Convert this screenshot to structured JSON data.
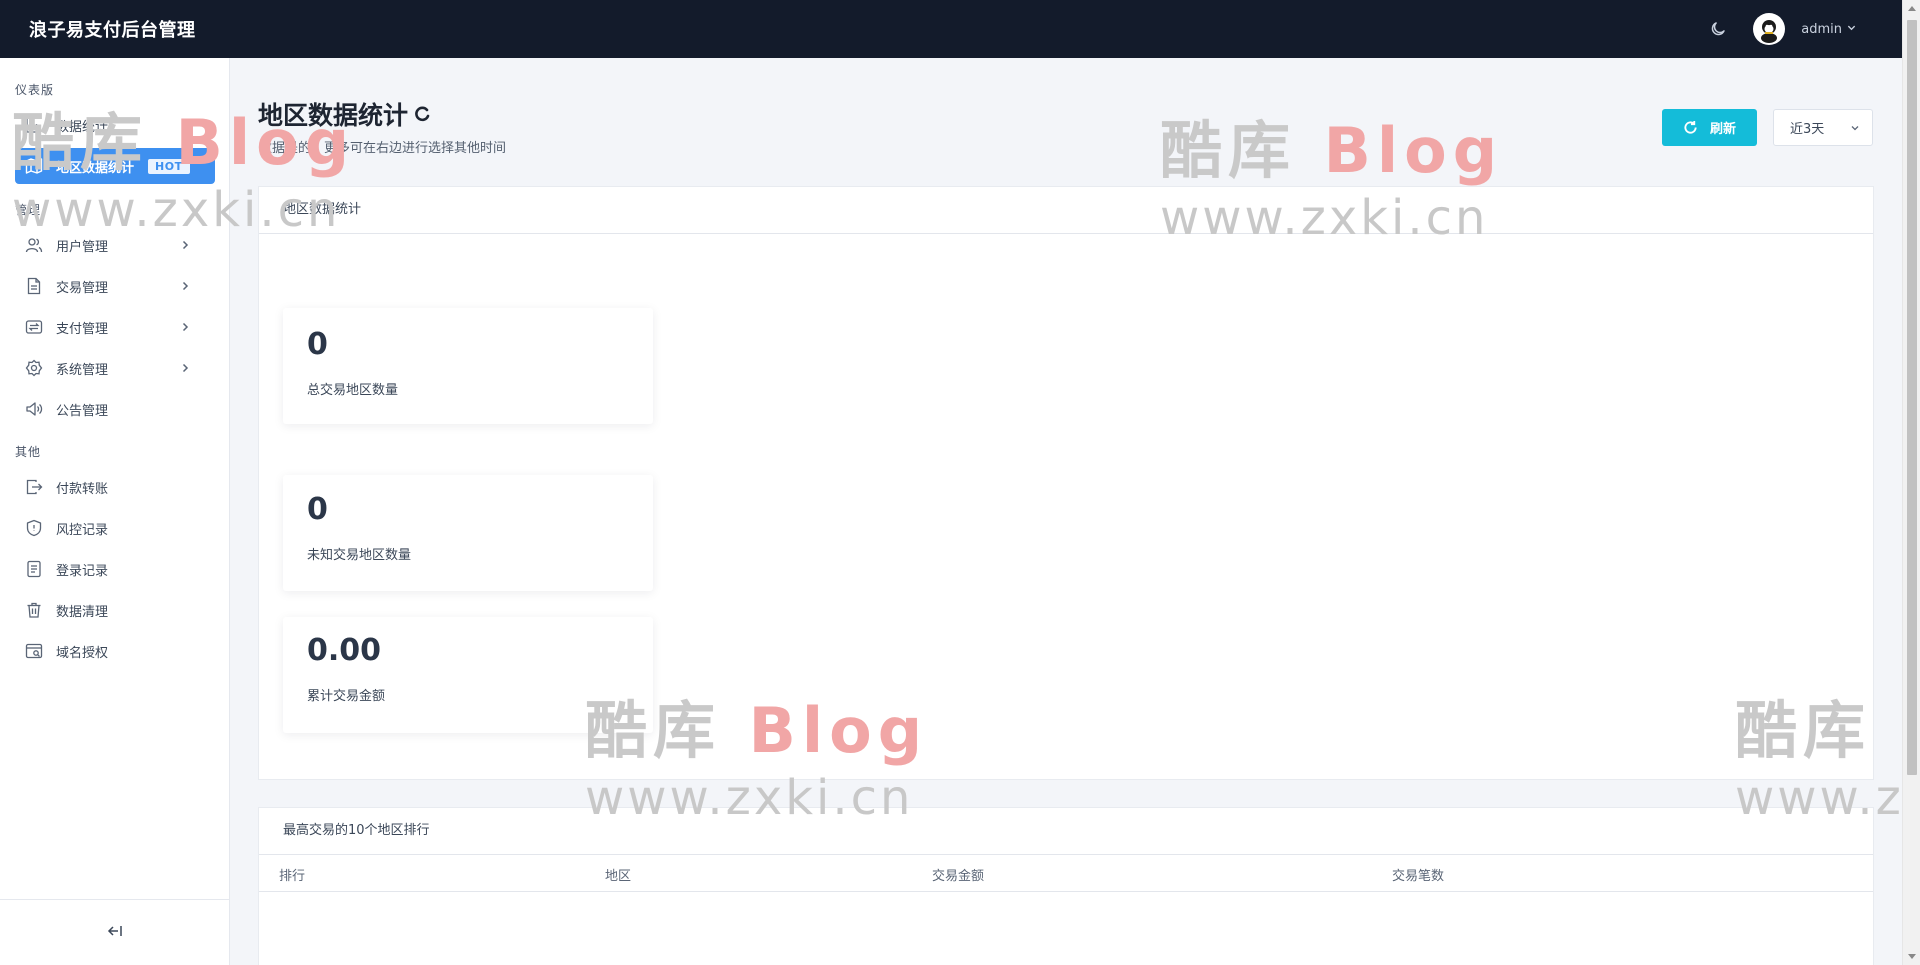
{
  "app": {
    "title": "浪子易支付后台管理"
  },
  "topbar": {
    "username": "admin"
  },
  "sidebar": {
    "sections": [
      {
        "title": "仪表版"
      },
      {
        "title": "管理"
      },
      {
        "title": "其他"
      }
    ],
    "items": [
      {
        "label": "数据统计",
        "icon": "bar-chart-icon"
      },
      {
        "label": "地区数据统计",
        "icon": "map-icon",
        "badge": "HOT",
        "active": true
      },
      {
        "label": "用户管理",
        "icon": "users-icon",
        "has_children": true
      },
      {
        "label": "交易管理",
        "icon": "document-icon",
        "has_children": true
      },
      {
        "label": "支付管理",
        "icon": "transfer-icon",
        "has_children": true
      },
      {
        "label": "系统管理",
        "icon": "gear-icon",
        "has_children": true
      },
      {
        "label": "公告管理",
        "icon": "speaker-icon"
      },
      {
        "label": "付款转账",
        "icon": "export-icon"
      },
      {
        "label": "风控记录",
        "icon": "shield-icon"
      },
      {
        "label": "登录记录",
        "icon": "log-icon"
      },
      {
        "label": "数据清理",
        "icon": "trash-icon"
      },
      {
        "label": "域名授权",
        "icon": "domain-icon"
      }
    ],
    "collapse_icon": "collapse-left-icon"
  },
  "page": {
    "title": "地区数据统计",
    "subtitle": "数据是的，更多可在右边进行选择其他时间",
    "refresh_label": "刷新",
    "range_value": "近3天"
  },
  "stats_card": {
    "header": "地区数据统计",
    "stats": [
      {
        "value": "0",
        "label": "总交易地区数量"
      },
      {
        "value": "0",
        "label": "未知交易地区数量"
      },
      {
        "value": "0.00",
        "label": "累计交易金额"
      }
    ]
  },
  "ranking_card": {
    "header": "最高交易的10个地区排行",
    "columns": [
      "排行",
      "地区",
      "交易金额",
      "交易笔数"
    ]
  },
  "watermark": {
    "brand_cn": "酷库",
    "brand_en": "Blog",
    "url": "www.zxki.cn"
  },
  "colors": {
    "topbar": "#131b2b",
    "accent": "#3e90f0",
    "refresh": "#14bcd9"
  }
}
